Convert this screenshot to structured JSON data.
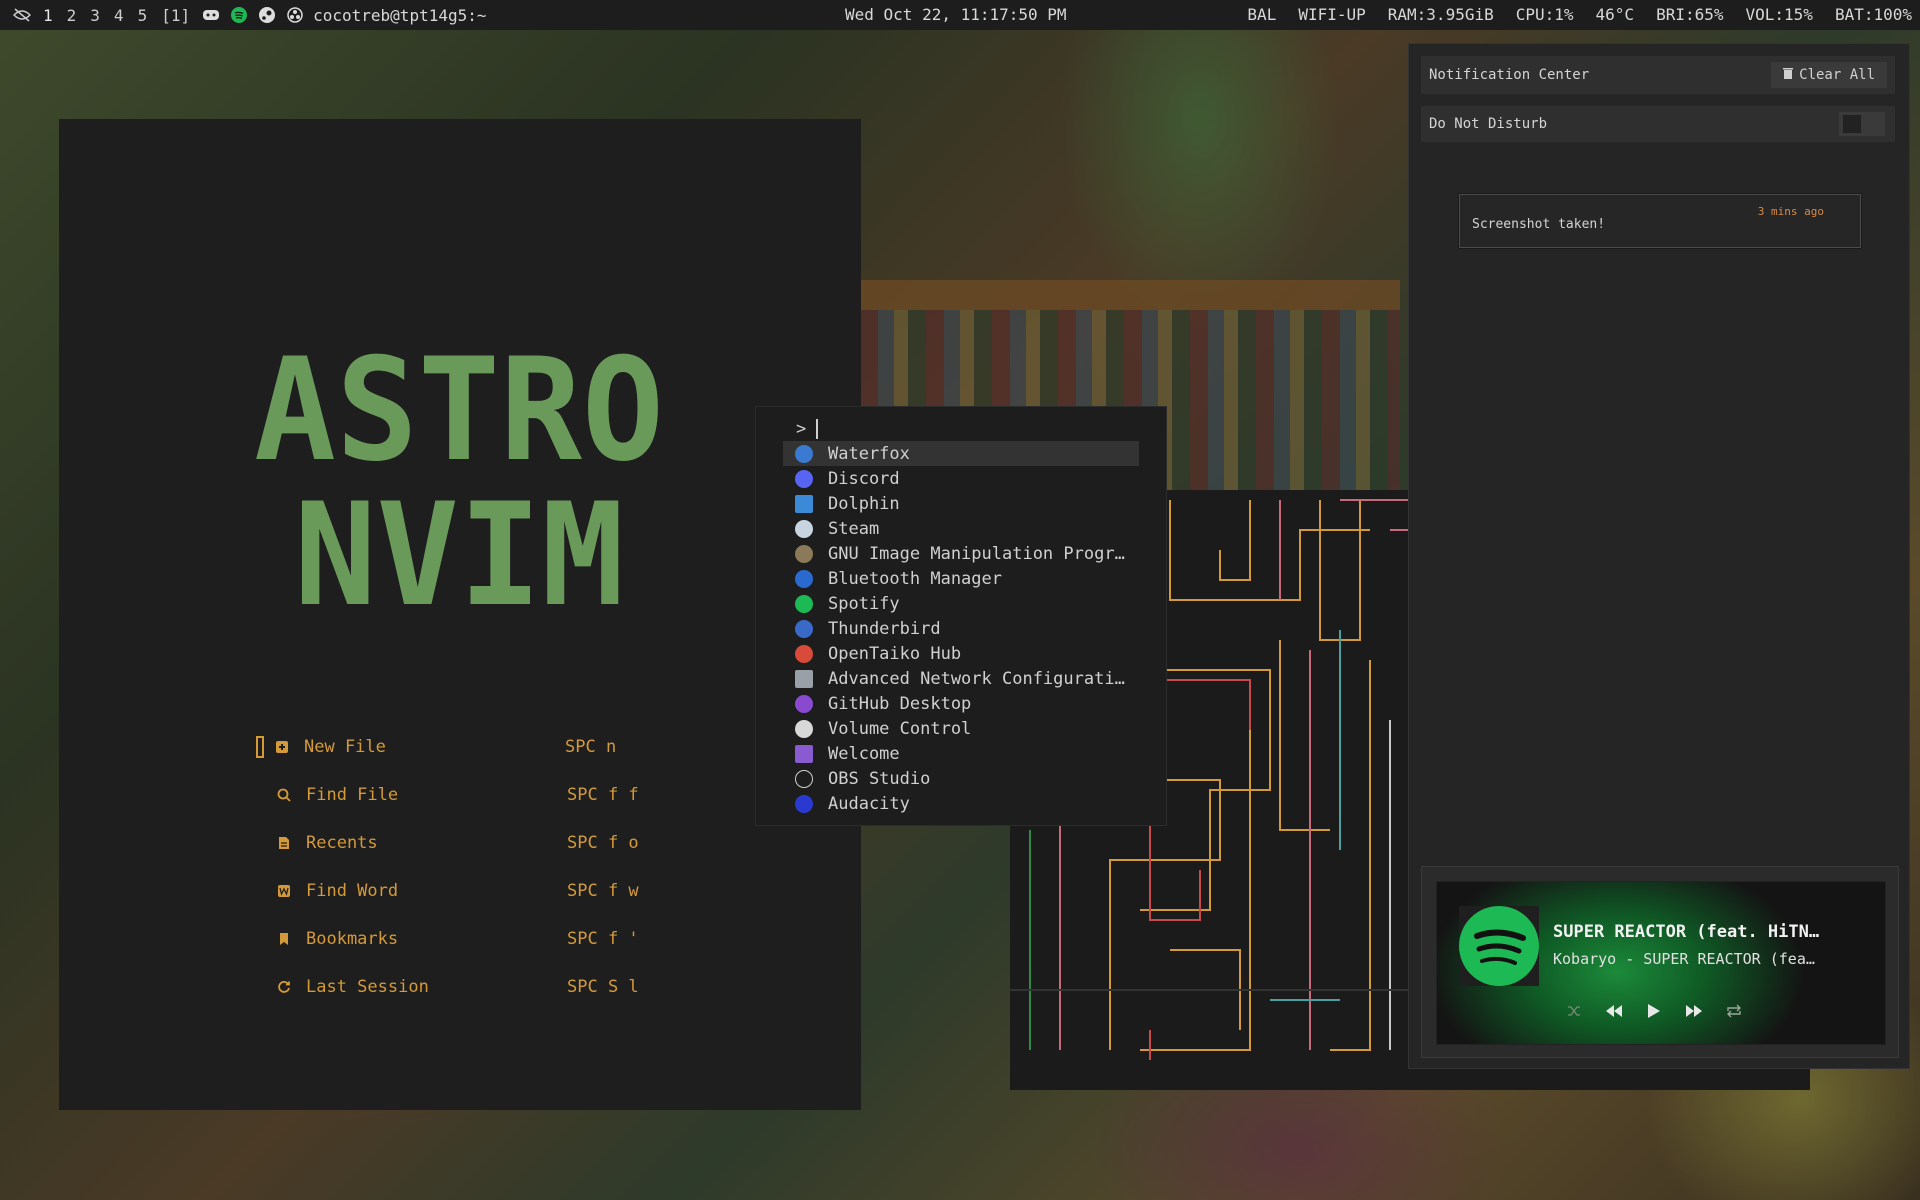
{
  "topbar": {
    "workspaces": [
      "1",
      "2",
      "3",
      "4",
      "5"
    ],
    "layout": "[1]",
    "tray_icons": [
      "discord-icon",
      "spotify-icon",
      "steam-icon",
      "obs-icon"
    ],
    "user_host": "cocotreb@tpt14g5:~",
    "datetime": "Wed Oct 22, 11:17:50 PM",
    "status": [
      "BAL",
      "WIFI-UP",
      "RAM:3.95GiB",
      "CPU:1%",
      "46°C",
      "BRI:65%",
      "VOL:15%",
      "BAT:100%"
    ]
  },
  "nvim": {
    "logo_lines": [
      "ASTRO",
      "NVIM"
    ],
    "logo_color": "#6a9a5a",
    "menu": [
      {
        "icon": "new-file-icon",
        "label": "New File",
        "key": "SPC n"
      },
      {
        "icon": "search-icon",
        "label": "Find File",
        "key": "SPC f f"
      },
      {
        "icon": "document-icon",
        "label": "Recents",
        "key": "SPC f o"
      },
      {
        "icon": "word-icon",
        "label": "Find Word",
        "key": "SPC f w"
      },
      {
        "icon": "bookmark-icon",
        "label": "Bookmarks",
        "key": "SPC f '"
      },
      {
        "icon": "restore-icon",
        "label": "Last Session",
        "key": "SPC S l"
      }
    ],
    "accent": "#d49a3a"
  },
  "launcher": {
    "prompt": ">",
    "items": [
      {
        "name": "Waterfox",
        "icon": "waterfox-icon",
        "color": "#3a7ad0"
      },
      {
        "name": "Discord",
        "icon": "discord-icon",
        "color": "#5865f2"
      },
      {
        "name": "Dolphin",
        "icon": "folder-icon",
        "color": "#3a8ad8"
      },
      {
        "name": "Steam",
        "icon": "steam-icon",
        "color": "#c8d4e0"
      },
      {
        "name": "GNU Image Manipulation Progr…",
        "icon": "gimp-icon",
        "color": "#8a7a5a"
      },
      {
        "name": "Bluetooth Manager",
        "icon": "bluetooth-icon",
        "color": "#2a6ad0"
      },
      {
        "name": "Spotify",
        "icon": "spotify-icon",
        "color": "#1db954"
      },
      {
        "name": "Thunderbird",
        "icon": "thunderbird-icon",
        "color": "#3a6ac8"
      },
      {
        "name": "OpenTaiko Hub",
        "icon": "taiko-icon",
        "color": "#d84a3a"
      },
      {
        "name": "Advanced Network Configurati…",
        "icon": "network-icon",
        "color": "#9aa0a8"
      },
      {
        "name": "GitHub Desktop",
        "icon": "github-icon",
        "color": "#8a4ad0"
      },
      {
        "name": "Volume Control",
        "icon": "volume-icon",
        "color": "#d8d8d8"
      },
      {
        "name": "Welcome",
        "icon": "welcome-icon",
        "color": "#8a5ad0"
      },
      {
        "name": "OBS Studio",
        "icon": "obs-icon",
        "color": "#cfcfcf"
      },
      {
        "name": "Audacity",
        "icon": "audacity-icon",
        "color": "#2a3ad0"
      }
    ],
    "selected_index": 0
  },
  "notification_center": {
    "title": "Notification Center",
    "clear_label": "Clear All",
    "dnd_label": "Do Not Disturb",
    "dnd_on": false,
    "notifications": [
      {
        "body": "Screenshot taken!",
        "time": "3 mins ago"
      }
    ]
  },
  "player": {
    "title": "SUPER REACTOR (feat. HiTN…",
    "artist": "Kobaryo - SUPER REACTOR (fea…",
    "controls": [
      "shuffle-icon",
      "previous-icon",
      "play-icon",
      "next-icon",
      "repeat-icon"
    ]
  }
}
